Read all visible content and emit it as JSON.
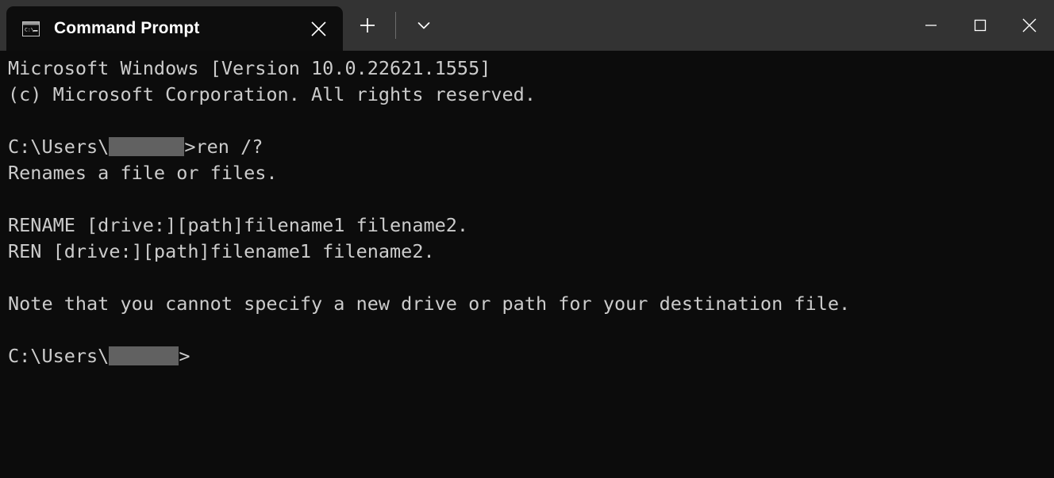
{
  "window": {
    "app_title": "Command Prompt",
    "background_color": "#0c0c0c",
    "titlebar_color": "#333333",
    "text_color": "#cccccc"
  },
  "titlebar": {
    "tabs": [
      {
        "label": "Command Prompt",
        "icon": "command-prompt-icon",
        "icon_text": "C:\\_",
        "active": true,
        "close_label": "×"
      }
    ],
    "new_tab_label": "+",
    "dropdown_label": "⌄",
    "controls": {
      "minimize_label": "–",
      "maximize_label": "□",
      "close_label": "×"
    }
  },
  "terminal": {
    "lines": [
      {
        "id": "l1",
        "text": "Microsoft Windows [Version 10.0.22621.1555]"
      },
      {
        "id": "l2",
        "text": "(c) Microsoft Corporation. All rights reserved."
      },
      {
        "id": "l3",
        "text": ""
      },
      {
        "id": "l4",
        "prompt": "C:\\Users\\",
        "redacted": true,
        "text": ">ren /?"
      },
      {
        "id": "l5",
        "text": "Renames a file or files."
      },
      {
        "id": "l6",
        "text": ""
      },
      {
        "id": "l7",
        "text": "RENAME [drive:][path]filename1 filename2."
      },
      {
        "id": "l8",
        "text": "REN [drive:][path]filename1 filename2."
      },
      {
        "id": "l9",
        "text": ""
      },
      {
        "id": "l10",
        "text": "Note that you cannot specify a new drive or path for your destination file."
      },
      {
        "id": "l11",
        "text": ""
      },
      {
        "id": "l12",
        "prompt": "C:\\Users\\",
        "redacted": true,
        "text": ">"
      }
    ],
    "line1": "Microsoft Windows [Version 10.0.22621.1555]",
    "line2": "(c) Microsoft Corporation. All rights reserved.",
    "line4_prompt": "C:\\Users\\",
    "line4_command": ">ren /?",
    "line5": "Renames a file or files.",
    "line7": "RENAME [drive:][path]filename1 filename2.",
    "line8": "REN [drive:][path]filename1 filename2.",
    "line10": "Note that you cannot specify a new drive or path for your destination file.",
    "line12_prompt": "C:\\Users\\",
    "line12_command": ">",
    "redaction_color": "#616161"
  }
}
